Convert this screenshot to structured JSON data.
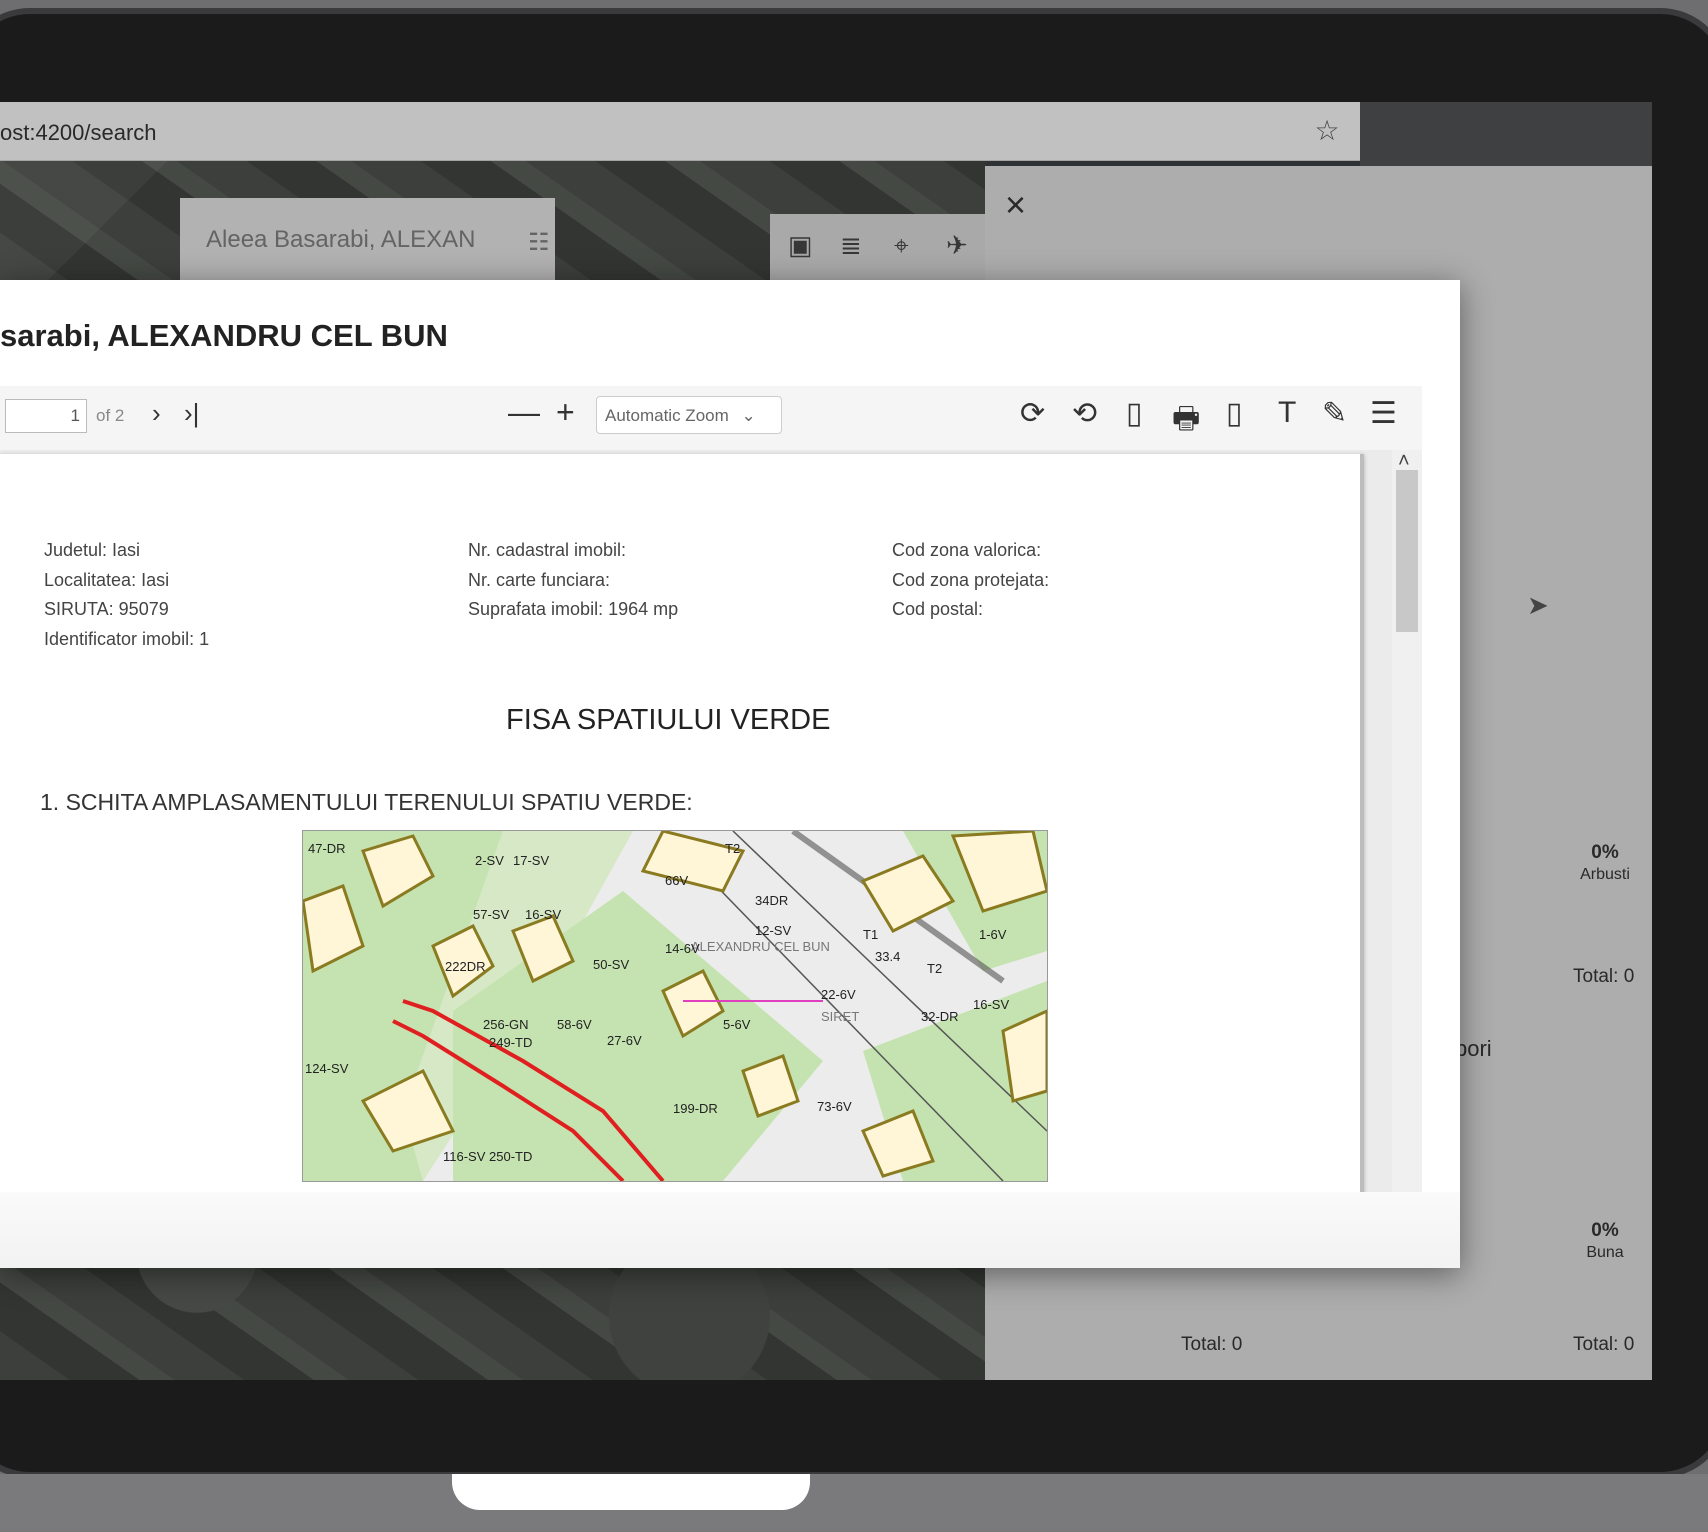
{
  "browser": {
    "url": "ost:4200/search"
  },
  "map": {
    "search_value": "Aleea Basarabi, ALEXAN",
    "tool_icons": [
      "folder-icon",
      "layers-icon",
      "location-off-icon",
      "satellite-icon"
    ]
  },
  "side_panel": {
    "close_symbol": "×",
    "stat_arbusti": {
      "pct": "0%",
      "label": "Arbusti",
      "total": "Total: 0"
    },
    "partial_text": "pori",
    "stat_buna": {
      "pct": "0%",
      "label": "Buna",
      "total": "Total: 0"
    },
    "bottom_total": "Total: 0"
  },
  "modal": {
    "title": "sarabi, ALEXANDRU CEL BUN",
    "toolbar": {
      "page_number": "1",
      "page_count": "of 2",
      "next_symbol": "›",
      "last_symbol": "›|",
      "zoom_out_symbol": "—",
      "zoom_in_symbol": "+",
      "zoom_value": "Automatic Zoom",
      "zoom_caret": "⌄",
      "icons": [
        "rotate-cw-icon",
        "rotate-ccw-icon",
        "document-properties-icon",
        "print-icon",
        "download-icon",
        "text-tool-icon",
        "draw-tool-icon",
        "menu-icon"
      ],
      "icon_glyphs": [
        "⟳",
        "⟲",
        "▯",
        "🖶",
        "▯",
        "T",
        "✎",
        "☰"
      ]
    },
    "document": {
      "col1": [
        "Judetul: Iasi",
        "Localitatea: Iasi",
        "SIRUTA: 95079",
        "Identificator imobil: 1"
      ],
      "col2": [
        "Nr. cadastral imobil:",
        "Nr. carte funciara:",
        "Suprafata imobil: 1964 mp"
      ],
      "col3": [
        "Cod zona valorica:",
        "Cod zona protejata:",
        "Cod postal:"
      ],
      "heading": "FISA SPATIULUI VERDE",
      "section": "1. SCHITA AMPLASAMENTULUI TERENULUI SPATIU VERDE:",
      "plan_labels": [
        "47-DR",
        "2-SV",
        "17-SV",
        "T2",
        "66V",
        "34DR",
        "57-SV",
        "16-SV",
        "ALEXANDRU CEL BUN",
        "12-SV",
        "T1",
        "33.4",
        "T2",
        "50-SV",
        "14-6V",
        "SIRET",
        "32-DR",
        "22-6V",
        "222DR",
        "256-GN",
        "58-6V",
        "27-6V",
        "5-6V",
        "249-TD",
        "73-6V",
        "116-SV 250-TD",
        "199-DR",
        "16-SV",
        "124-SV",
        "1-6V"
      ]
    }
  },
  "colors": {
    "plan_green": "#c5e3b0",
    "plan_red": "#e02020",
    "plan_magenta": "#e040c0",
    "building_fill": "#fff6d8",
    "building_stroke": "#8a7a20"
  }
}
